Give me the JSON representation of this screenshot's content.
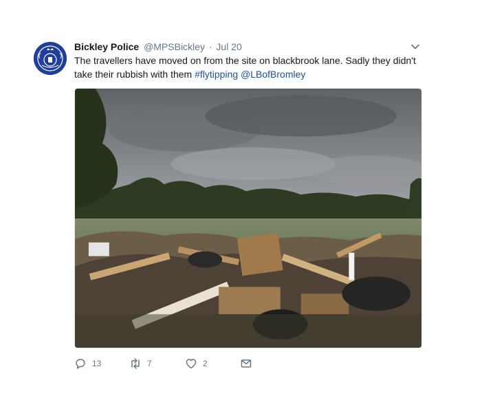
{
  "tweet": {
    "author_name": "Bickley Police",
    "handle": "@MPSBickley",
    "separator": "·",
    "date": "Jul 20",
    "text_plain": "The travellers have moved on from the site on blackbrook lane. Sadly they didn't take their rubbish with them ",
    "hashtag": "#flytipping",
    "mention": "@LBofBromley",
    "avatar_icon": "police-crest-icon",
    "menu_icon": "chevron-down-icon",
    "media_description_icon": "photo"
  },
  "actions": {
    "reply": {
      "icon": "reply-icon",
      "count": "13"
    },
    "retweet": {
      "icon": "retweet-icon",
      "count": "7"
    },
    "like": {
      "icon": "heart-icon",
      "count": "2"
    },
    "message": {
      "icon": "envelope-icon"
    }
  },
  "colors": {
    "link": "#1b4f9c",
    "muted": "#657786",
    "text": "#14171a",
    "avatar_bg": "#1f3f9a"
  }
}
